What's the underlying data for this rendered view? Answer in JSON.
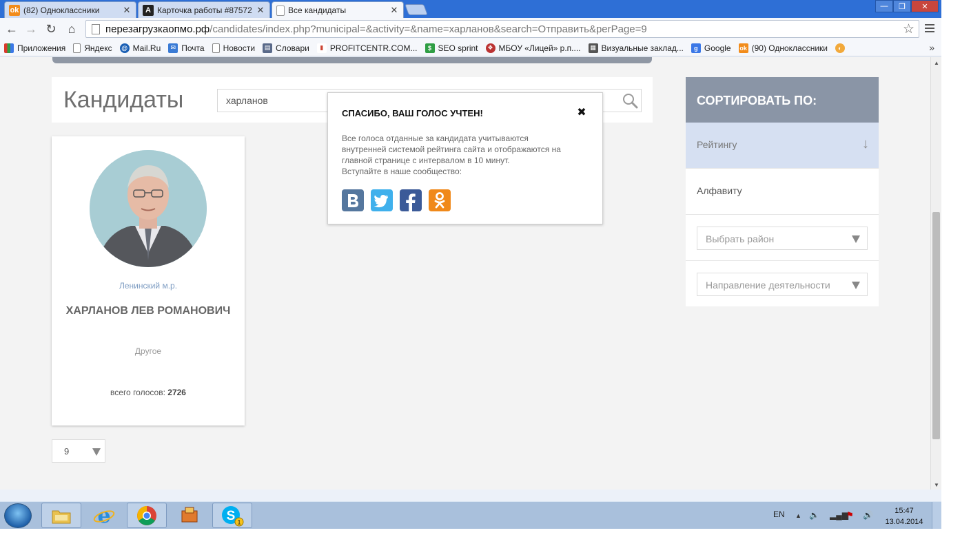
{
  "browser": {
    "tabs": [
      {
        "title": "(82) Одноклассники",
        "icon": "odnoklassniki-icon",
        "active": false
      },
      {
        "title": "Карточка работы #87572",
        "icon": "letter-a-icon",
        "active": false
      },
      {
        "title": "Все кандидаты",
        "icon": "page-icon",
        "active": true
      }
    ],
    "url_host": "перезагрузкаопмо.рф",
    "url_path": "/candidates/index.php?municipal=&activity=&name=харланов&search=Отправить&perPage=9",
    "bookmarks": [
      {
        "label": "Приложения",
        "icon": "apps-grid-icon",
        "color": "#d83b2d"
      },
      {
        "label": "Яндекс",
        "icon": "page-icon",
        "color": "#888888"
      },
      {
        "label": "Mail.Ru",
        "icon": "mailru-icon",
        "color": "#1a5fb4"
      },
      {
        "label": "Почта",
        "icon": "mail-icon",
        "color": "#3a7bd5"
      },
      {
        "label": "Новости",
        "icon": "page-icon",
        "color": "#888888"
      },
      {
        "label": "Словари",
        "icon": "dictionary-icon",
        "color": "#5a6a8a"
      },
      {
        "label": "PROFITCENTR.COM...",
        "icon": "bar-chart-icon",
        "color": "#c43"
      },
      {
        "label": "SEO sprint",
        "icon": "seo-sprint-icon",
        "color": "#2f9e44"
      },
      {
        "label": "МБОУ «Лицей» р.п....",
        "icon": "school-crest-icon",
        "color": "#b33"
      },
      {
        "label": "Визуальные заклад...",
        "icon": "grid-icon",
        "color": "#555555"
      },
      {
        "label": "Google",
        "icon": "google-icon",
        "color": "#3b78e7"
      },
      {
        "label": "(90) Одноклассники",
        "icon": "odnoklassniki-icon",
        "color": "#f28c1b"
      }
    ],
    "more_label": "»"
  },
  "page": {
    "title": "Кандидаты",
    "search_value": "харланов",
    "candidate": {
      "district": "Ленинский м.р.",
      "name": "ХАРЛАНОВ ЛЕВ РОМАНОВИЧ",
      "category": "Другое",
      "votes_label": "всего голосов:",
      "votes_value": "2726"
    },
    "per_page": "9",
    "sort": {
      "header": "СОРТИРОВАТЬ ПО:",
      "options": [
        "Рейтингу",
        "Алфавиту"
      ],
      "active_option": "Рейтингу",
      "district_select": "Выбрать район",
      "activity_select": "Направление деятельности"
    }
  },
  "modal": {
    "title": "СПАСИБО, ВАШ ГОЛОС УЧТЕН!",
    "close": "✖",
    "text_lines": [
      "Все голоса отданные за кандидата учитываются",
      "внутренней системой рейтинга сайта и отображаются на",
      "главной странице с интервалом в 10 минут.",
      "Вступайте в наше сообщество:"
    ],
    "social": [
      {
        "name": "vk",
        "icon": "vk-icon",
        "color": "#55779e",
        "glyph": "B"
      },
      {
        "name": "twitter",
        "icon": "twitter-icon",
        "color": "#3fb0ec",
        "glyph": "t"
      },
      {
        "name": "facebook",
        "icon": "facebook-icon",
        "color": "#3b5a98",
        "glyph": "f"
      },
      {
        "name": "odnoklassniki",
        "icon": "odnoklassniki-icon",
        "color": "#f0891a",
        "glyph": "ok"
      }
    ]
  },
  "taskbar": {
    "lang": "EN",
    "time": "15:47",
    "date": "13.04.2014",
    "skype_badge": "1"
  }
}
